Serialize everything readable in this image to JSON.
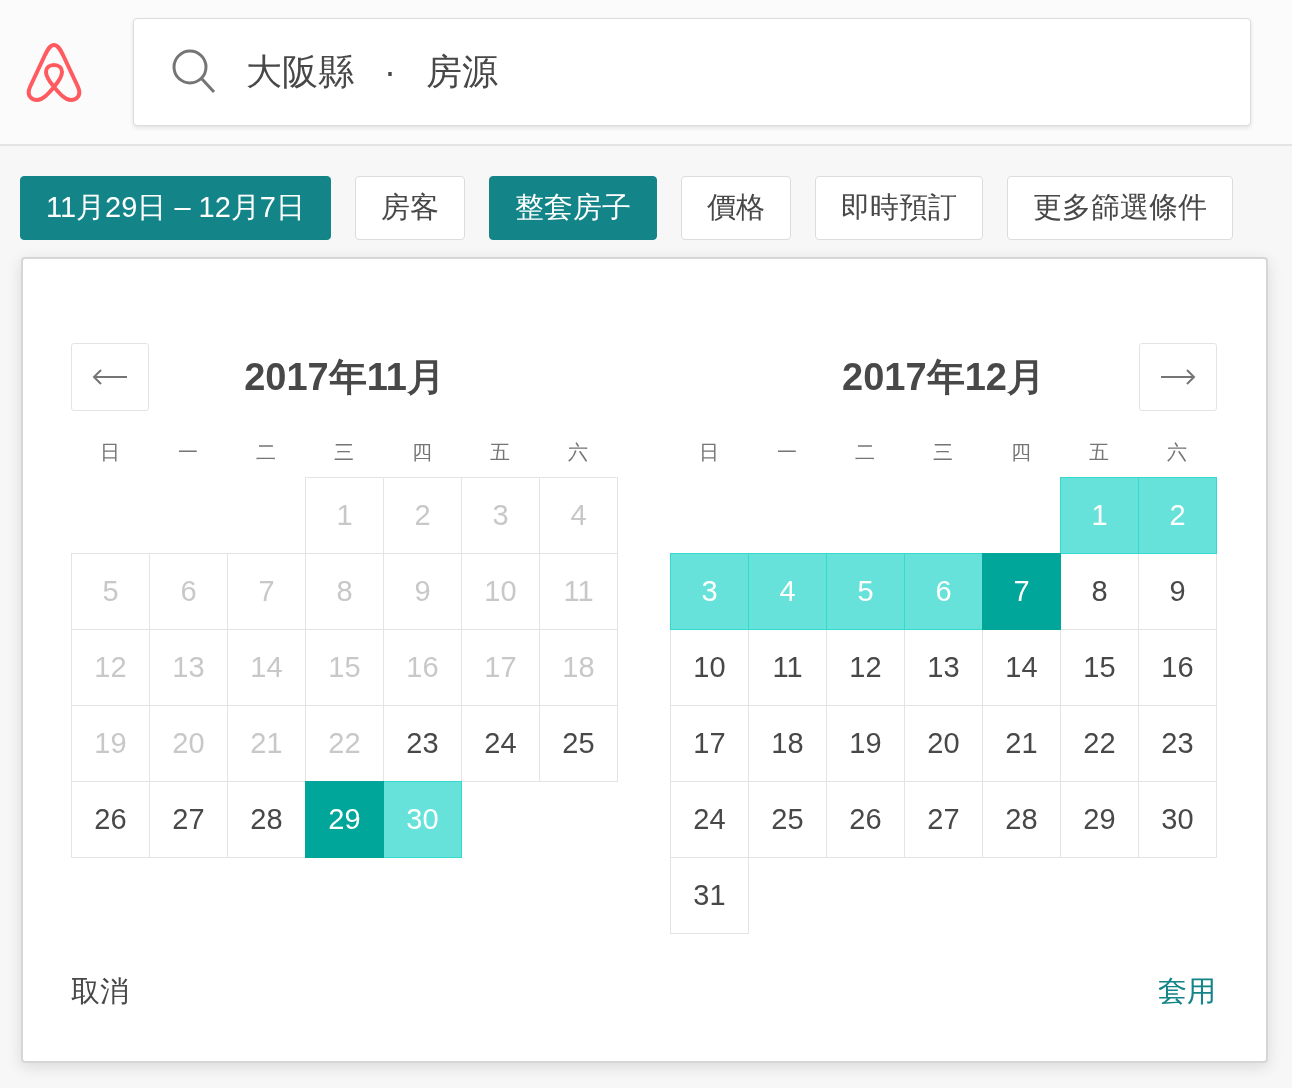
{
  "search": {
    "location": "大阪縣",
    "separator": "·",
    "type": "房源"
  },
  "filters": [
    {
      "label": "11月29日 – 12月7日",
      "selected": true
    },
    {
      "label": "房客",
      "selected": false
    },
    {
      "label": "整套房子",
      "selected": true
    },
    {
      "label": "價格",
      "selected": false
    },
    {
      "label": "即時預訂",
      "selected": false
    },
    {
      "label": "更多篩選條件",
      "selected": false
    }
  ],
  "calendar": {
    "months": [
      {
        "title": "2017年11月",
        "weekdays": [
          "日",
          "一",
          "二",
          "三",
          "四",
          "五",
          "六"
        ],
        "weeks": [
          [
            {
              "kind": "blank"
            },
            {
              "kind": "blank"
            },
            {
              "kind": "blank"
            },
            {
              "kind": "day",
              "day": "1",
              "disabled": true,
              "selected": false,
              "in_range": false
            },
            {
              "kind": "day",
              "day": "2",
              "disabled": true,
              "selected": false,
              "in_range": false
            },
            {
              "kind": "day",
              "day": "3",
              "disabled": true,
              "selected": false,
              "in_range": false
            },
            {
              "kind": "day",
              "day": "4",
              "disabled": true,
              "selected": false,
              "in_range": false
            }
          ],
          [
            {
              "kind": "day",
              "day": "5",
              "disabled": true,
              "selected": false,
              "in_range": false
            },
            {
              "kind": "day",
              "day": "6",
              "disabled": true,
              "selected": false,
              "in_range": false
            },
            {
              "kind": "day",
              "day": "7",
              "disabled": true,
              "selected": false,
              "in_range": false
            },
            {
              "kind": "day",
              "day": "8",
              "disabled": true,
              "selected": false,
              "in_range": false
            },
            {
              "kind": "day",
              "day": "9",
              "disabled": true,
              "selected": false,
              "in_range": false
            },
            {
              "kind": "day",
              "day": "10",
              "disabled": true,
              "selected": false,
              "in_range": false
            },
            {
              "kind": "day",
              "day": "11",
              "disabled": true,
              "selected": false,
              "in_range": false
            }
          ],
          [
            {
              "kind": "day",
              "day": "12",
              "disabled": true,
              "selected": false,
              "in_range": false
            },
            {
              "kind": "day",
              "day": "13",
              "disabled": true,
              "selected": false,
              "in_range": false
            },
            {
              "kind": "day",
              "day": "14",
              "disabled": true,
              "selected": false,
              "in_range": false
            },
            {
              "kind": "day",
              "day": "15",
              "disabled": true,
              "selected": false,
              "in_range": false
            },
            {
              "kind": "day",
              "day": "16",
              "disabled": true,
              "selected": false,
              "in_range": false
            },
            {
              "kind": "day",
              "day": "17",
              "disabled": true,
              "selected": false,
              "in_range": false
            },
            {
              "kind": "day",
              "day": "18",
              "disabled": true,
              "selected": false,
              "in_range": false
            }
          ],
          [
            {
              "kind": "day",
              "day": "19",
              "disabled": true,
              "selected": false,
              "in_range": false
            },
            {
              "kind": "day",
              "day": "20",
              "disabled": true,
              "selected": false,
              "in_range": false
            },
            {
              "kind": "day",
              "day": "21",
              "disabled": true,
              "selected": false,
              "in_range": false
            },
            {
              "kind": "day",
              "day": "22",
              "disabled": true,
              "selected": false,
              "in_range": false
            },
            {
              "kind": "day",
              "day": "23",
              "disabled": false,
              "selected": false,
              "in_range": false
            },
            {
              "kind": "day",
              "day": "24",
              "disabled": false,
              "selected": false,
              "in_range": false
            },
            {
              "kind": "day",
              "day": "25",
              "disabled": false,
              "selected": false,
              "in_range": false
            }
          ],
          [
            {
              "kind": "day",
              "day": "26",
              "disabled": false,
              "selected": false,
              "in_range": false
            },
            {
              "kind": "day",
              "day": "27",
              "disabled": false,
              "selected": false,
              "in_range": false
            },
            {
              "kind": "day",
              "day": "28",
              "disabled": false,
              "selected": false,
              "in_range": false
            },
            {
              "kind": "day",
              "day": "29",
              "disabled": false,
              "selected": true,
              "in_range": false
            },
            {
              "kind": "day",
              "day": "30",
              "disabled": false,
              "selected": false,
              "in_range": true
            },
            {
              "kind": "blank"
            },
            {
              "kind": "blank"
            }
          ]
        ]
      },
      {
        "title": "2017年12月",
        "weekdays": [
          "日",
          "一",
          "二",
          "三",
          "四",
          "五",
          "六"
        ],
        "weeks": [
          [
            {
              "kind": "blank"
            },
            {
              "kind": "blank"
            },
            {
              "kind": "blank"
            },
            {
              "kind": "blank"
            },
            {
              "kind": "blank"
            },
            {
              "kind": "day",
              "day": "1",
              "disabled": false,
              "selected": false,
              "in_range": true
            },
            {
              "kind": "day",
              "day": "2",
              "disabled": false,
              "selected": false,
              "in_range": true
            }
          ],
          [
            {
              "kind": "day",
              "day": "3",
              "disabled": false,
              "selected": false,
              "in_range": true
            },
            {
              "kind": "day",
              "day": "4",
              "disabled": false,
              "selected": false,
              "in_range": true
            },
            {
              "kind": "day",
              "day": "5",
              "disabled": false,
              "selected": false,
              "in_range": true
            },
            {
              "kind": "day",
              "day": "6",
              "disabled": false,
              "selected": false,
              "in_range": true
            },
            {
              "kind": "day",
              "day": "7",
              "disabled": false,
              "selected": true,
              "in_range": false
            },
            {
              "kind": "day",
              "day": "8",
              "disabled": false,
              "selected": false,
              "in_range": false
            },
            {
              "kind": "day",
              "day": "9",
              "disabled": false,
              "selected": false,
              "in_range": false
            }
          ],
          [
            {
              "kind": "day",
              "day": "10",
              "disabled": false,
              "selected": false,
              "in_range": false
            },
            {
              "kind": "day",
              "day": "11",
              "disabled": false,
              "selected": false,
              "in_range": false
            },
            {
              "kind": "day",
              "day": "12",
              "disabled": false,
              "selected": false,
              "in_range": false
            },
            {
              "kind": "day",
              "day": "13",
              "disabled": false,
              "selected": false,
              "in_range": false
            },
            {
              "kind": "day",
              "day": "14",
              "disabled": false,
              "selected": false,
              "in_range": false
            },
            {
              "kind": "day",
              "day": "15",
              "disabled": false,
              "selected": false,
              "in_range": false
            },
            {
              "kind": "day",
              "day": "16",
              "disabled": false,
              "selected": false,
              "in_range": false
            }
          ],
          [
            {
              "kind": "day",
              "day": "17",
              "disabled": false,
              "selected": false,
              "in_range": false
            },
            {
              "kind": "day",
              "day": "18",
              "disabled": false,
              "selected": false,
              "in_range": false
            },
            {
              "kind": "day",
              "day": "19",
              "disabled": false,
              "selected": false,
              "in_range": false
            },
            {
              "kind": "day",
              "day": "20",
              "disabled": false,
              "selected": false,
              "in_range": false
            },
            {
              "kind": "day",
              "day": "21",
              "disabled": false,
              "selected": false,
              "in_range": false
            },
            {
              "kind": "day",
              "day": "22",
              "disabled": false,
              "selected": false,
              "in_range": false
            },
            {
              "kind": "day",
              "day": "23",
              "disabled": false,
              "selected": false,
              "in_range": false
            }
          ],
          [
            {
              "kind": "day",
              "day": "24",
              "disabled": false,
              "selected": false,
              "in_range": false
            },
            {
              "kind": "day",
              "day": "25",
              "disabled": false,
              "selected": false,
              "in_range": false
            },
            {
              "kind": "day",
              "day": "26",
              "disabled": false,
              "selected": false,
              "in_range": false
            },
            {
              "kind": "day",
              "day": "27",
              "disabled": false,
              "selected": false,
              "in_range": false
            },
            {
              "kind": "day",
              "day": "28",
              "disabled": false,
              "selected": false,
              "in_range": false
            },
            {
              "kind": "day",
              "day": "29",
              "disabled": false,
              "selected": false,
              "in_range": false
            },
            {
              "kind": "day",
              "day": "30",
              "disabled": false,
              "selected": false,
              "in_range": false
            }
          ],
          [
            {
              "kind": "day",
              "day": "31",
              "disabled": false,
              "selected": false,
              "in_range": false
            },
            {
              "kind": "blank"
            },
            {
              "kind": "blank"
            },
            {
              "kind": "blank"
            },
            {
              "kind": "blank"
            },
            {
              "kind": "blank"
            },
            {
              "kind": "blank"
            }
          ]
        ]
      }
    ],
    "cancel": "取消",
    "apply": "套用"
  }
}
